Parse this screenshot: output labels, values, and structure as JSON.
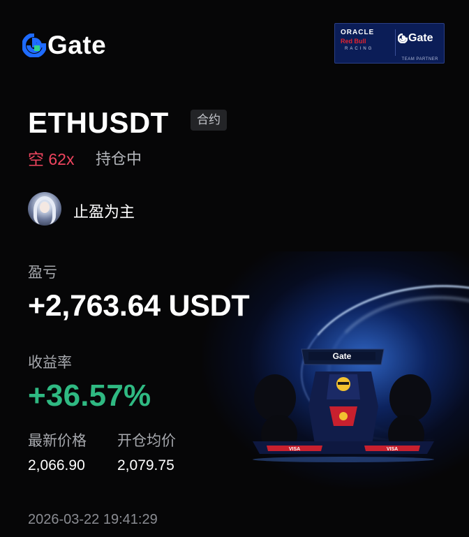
{
  "brand": {
    "name": "Gate",
    "logo_icon": "gate-logo-icon"
  },
  "partner_badge": {
    "line1": "ORACLE",
    "line2": "Red Bull",
    "line3": "RACING",
    "brand": "Gate",
    "footer": "TEAM PARTNER"
  },
  "position": {
    "pair": "ETHUSDT",
    "type_tag": "合约",
    "side": "空 62x",
    "status": "持仓中"
  },
  "trader": {
    "nickname": "止盈为主"
  },
  "pnl": {
    "label": "盈亏",
    "value": "+2,763.64 USDT"
  },
  "roi": {
    "label": "收益率",
    "value": "+36.57%"
  },
  "prices": {
    "last_label": "最新价格",
    "last_value": "2,066.90",
    "entry_label": "开仓均价",
    "entry_value": "2,079.75"
  },
  "timestamp": "2026-03-22 19:41:29",
  "colors": {
    "background": "#060607",
    "short": "#f0455f",
    "profit": "#2fb982",
    "muted": "#a6a8ad",
    "brand_blue": "#1e6bff"
  }
}
